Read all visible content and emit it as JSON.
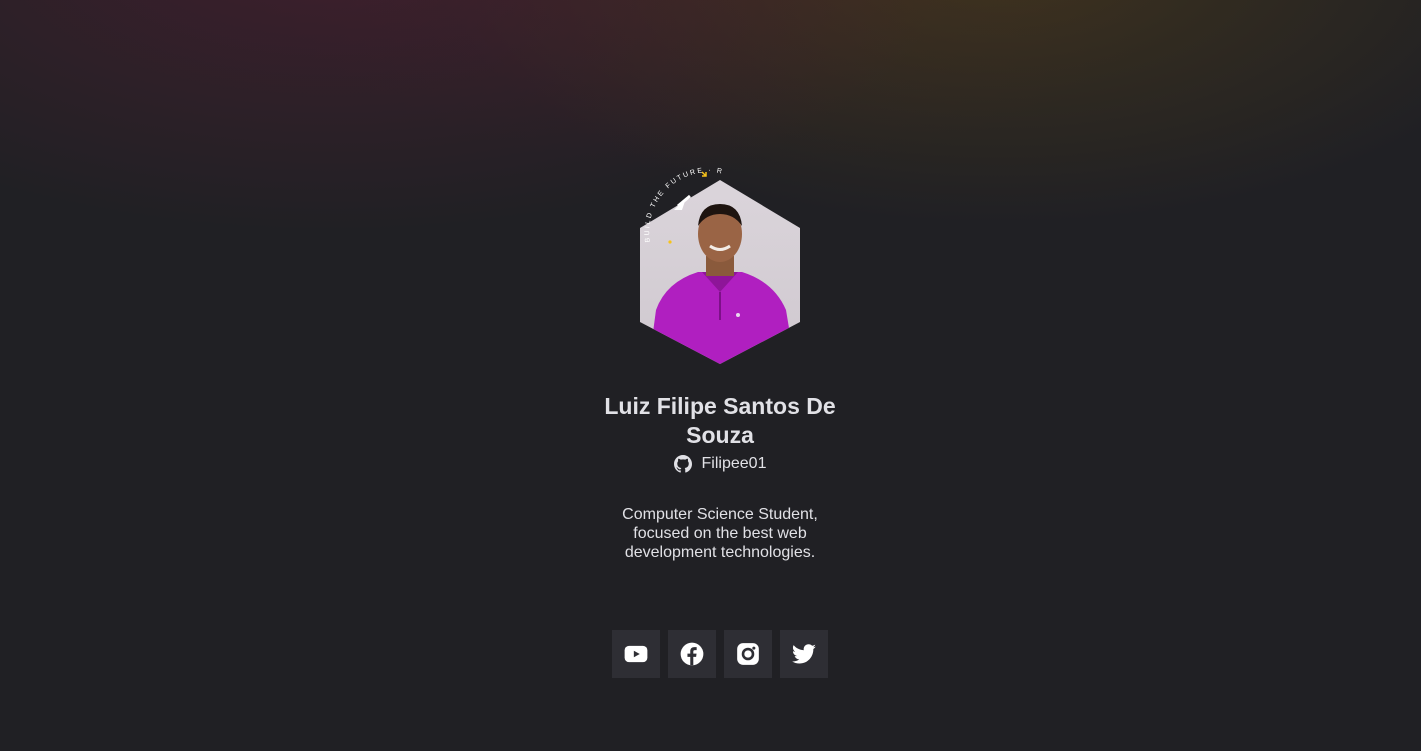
{
  "profile": {
    "name": "Luiz Filipe Santos De Souza",
    "github_username": "Filipee01",
    "bio": "Computer Science Student, focused on the best web development technologies.",
    "badge_text": "BUILD THE FUTURE · ROCKETSEAT"
  },
  "social_links": [
    {
      "name": "youtube",
      "icon": "youtube-icon"
    },
    {
      "name": "facebook",
      "icon": "facebook-icon"
    },
    {
      "name": "instagram",
      "icon": "instagram-icon"
    },
    {
      "name": "twitter",
      "icon": "twitter-icon"
    }
  ],
  "colors": {
    "background": "#202024",
    "button_bg": "#2e2e34",
    "text": "#e1e1e6",
    "shirt": "#b01fc0",
    "badge_accent": "#f7c31a"
  }
}
